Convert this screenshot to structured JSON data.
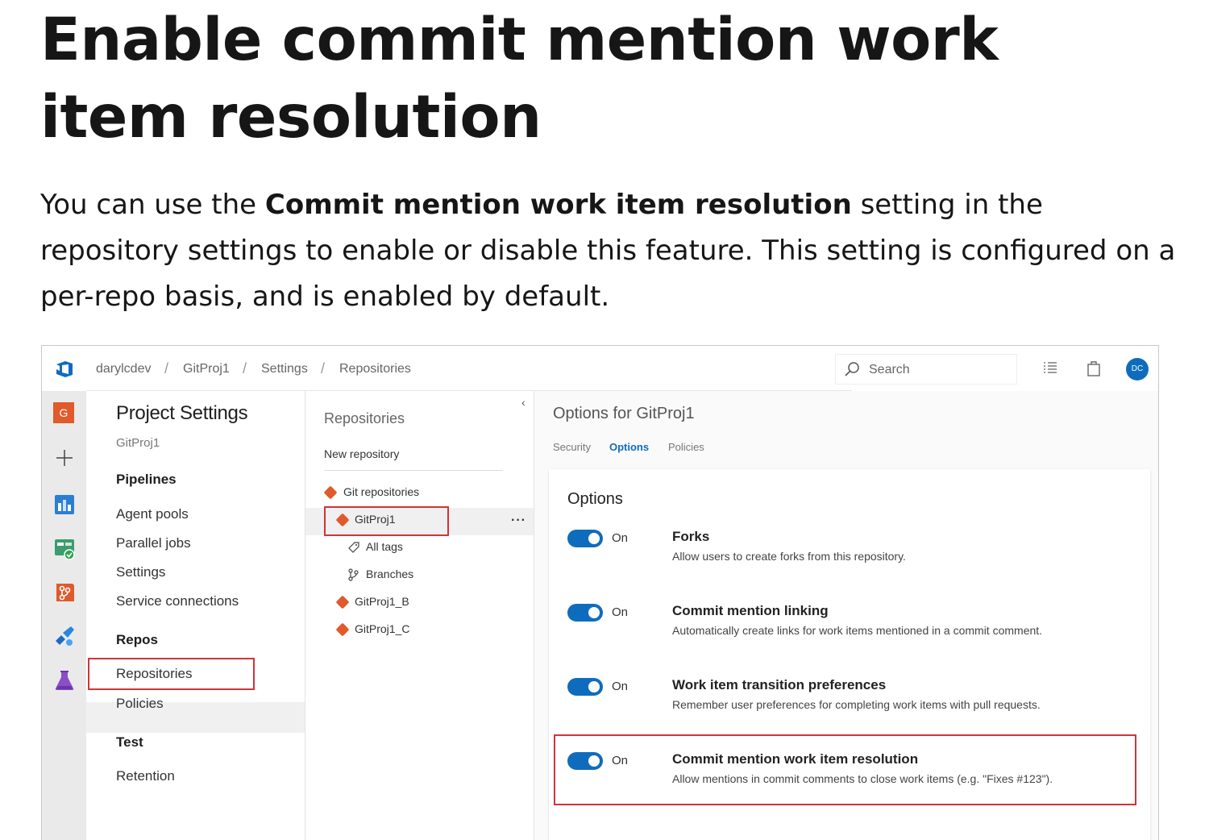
{
  "doc": {
    "title": "Enable commit mention work item resolution",
    "para_prefix": "You can use the ",
    "para_bold": "Commit mention work item resolution",
    "para_suffix": " setting in the repository settings to enable or disable this feature. This setting is configured on a per-repo basis, and is enabled by default."
  },
  "colors": {
    "accent": "#0f6cbd",
    "highlight_border": "#d13438",
    "git_icon": "#e05a2b"
  },
  "topbar": {
    "breadcrumb": [
      "darylcdev",
      "GitProj1",
      "Settings",
      "Repositories"
    ],
    "separator": "/",
    "search_placeholder": "Search",
    "avatar_initials": "DC"
  },
  "rail": {
    "project_initial": "G",
    "icons": [
      "project-icon",
      "add-icon",
      "boards-icon",
      "pipelines-icon",
      "repos-icon",
      "deploy-icon",
      "test-plans-icon"
    ]
  },
  "settings_nav": {
    "title": "Project Settings",
    "subtitle": "GitProj1",
    "sections": [
      {
        "label": "Pipelines",
        "items": [
          "Agent pools",
          "Parallel jobs",
          "Settings",
          "Service connections"
        ]
      },
      {
        "label": "Repos",
        "items": [
          "Repositories",
          "Policies"
        ]
      },
      {
        "label": "Test",
        "items": [
          "Retention"
        ]
      }
    ],
    "selected": "Repositories"
  },
  "repos_panel": {
    "title": "Repositories",
    "new_repository": "New repository",
    "collapse_glyph": "‹",
    "tree": {
      "group": "Git repositories",
      "selected_repo": "GitProj1",
      "children": [
        "All tags",
        "Branches"
      ],
      "other_repos": [
        "GitProj1_B",
        "GitProj1_C"
      ]
    },
    "more_glyph": "···"
  },
  "options_panel": {
    "title": "Options for GitProj1",
    "tabs": [
      "Security",
      "Options",
      "Policies"
    ],
    "active_tab": "Options",
    "card_title": "Options",
    "settings": [
      {
        "state": "On",
        "title": "Forks",
        "description": "Allow users to create forks from this repository."
      },
      {
        "state": "On",
        "title": "Commit mention linking",
        "description": "Automatically create links for work items mentioned in a commit comment."
      },
      {
        "state": "On",
        "title": "Work item transition preferences",
        "description": "Remember user preferences for completing work items with pull requests."
      },
      {
        "state": "On",
        "title": "Commit mention work item resolution",
        "description": "Allow mentions in commit comments to close work items (e.g. \"Fixes #123\")."
      }
    ]
  }
}
